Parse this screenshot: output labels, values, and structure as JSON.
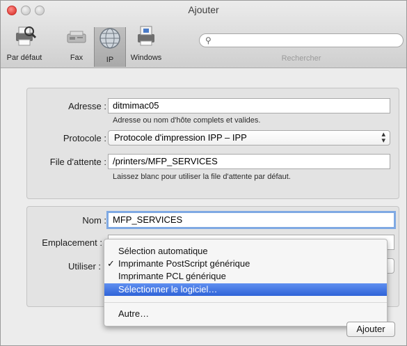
{
  "window": {
    "title": "Ajouter"
  },
  "toolbar": {
    "items": [
      {
        "label": "Par défaut",
        "icon": "printer-magnifier-icon"
      },
      {
        "label": "Fax",
        "icon": "fax-icon"
      },
      {
        "label": "IP",
        "icon": "globe-icon",
        "selected": true
      },
      {
        "label": "Windows",
        "icon": "windows-printer-icon"
      }
    ],
    "search_label": "Rechercher",
    "search_value": ""
  },
  "connection": {
    "address_label": "Adresse :",
    "address_value": "ditmimac05",
    "address_hint": "Adresse ou nom d'hôte complets et valides.",
    "protocol_label": "Protocole :",
    "protocol_value": "Protocole d'impression IPP – IPP",
    "queue_label": "File d'attente :",
    "queue_value": "/printers/MFP_SERVICES",
    "queue_hint": "Laissez blanc pour utiliser la file d'attente par défaut."
  },
  "printer": {
    "name_label": "Nom :",
    "name_value": "MFP_SERVICES",
    "location_label": "Emplacement :",
    "location_value": "",
    "use_label": "Utiliser :"
  },
  "menu": {
    "items": [
      {
        "label": "Sélection automatique",
        "checked": false,
        "highlighted": false
      },
      {
        "label": "Imprimante PostScript générique",
        "checked": true,
        "highlighted": false
      },
      {
        "label": "Imprimante PCL générique",
        "checked": false,
        "highlighted": false
      },
      {
        "label": "Sélectionner le logiciel…",
        "checked": false,
        "highlighted": true
      },
      {
        "label": "Autre…",
        "checked": false,
        "highlighted": false
      }
    ],
    "check_mark": "✓"
  },
  "buttons": {
    "add_label": "Ajouter"
  },
  "colors": {
    "highlight": "#2f63d8",
    "close": "#e0443e"
  }
}
